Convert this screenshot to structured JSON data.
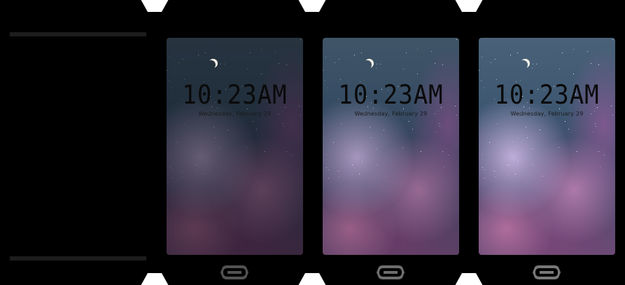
{
  "lockscreen": {
    "time": "10:23AM",
    "date": "Wednesday, February 29"
  },
  "phones": [
    {
      "state": "off",
      "screen_brightness": 0.0
    },
    {
      "state": "dim",
      "screen_brightness": 0.45
    },
    {
      "state": "medium",
      "screen_brightness": 0.85
    },
    {
      "state": "bright",
      "screen_brightness": 1.0
    }
  ],
  "icons": {
    "moon": "crescent-moon-icon",
    "home": "home-button-icon"
  },
  "colors": {
    "background": "#000000",
    "moon": "#f4f0e6",
    "clock_text": "#0a0a0a",
    "home_button": "#555555"
  }
}
